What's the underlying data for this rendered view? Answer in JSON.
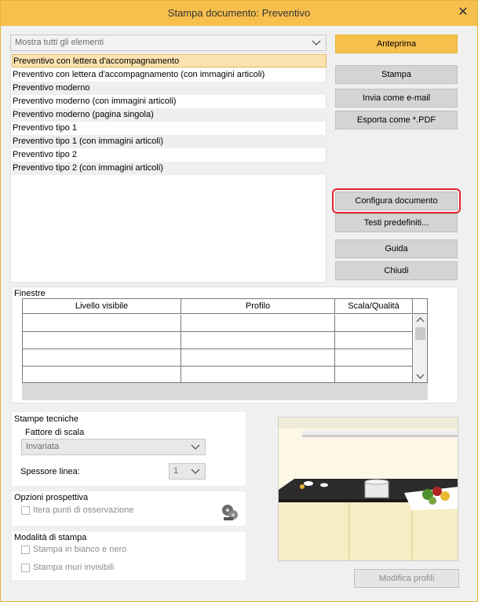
{
  "window": {
    "title": "Stampa documento: Preventivo"
  },
  "filter": {
    "value": "Mostra tutti gli elementi"
  },
  "templates": [
    "Preventivo con lettera d'accompagnamento",
    "Preventivo con lettera d'accompagnamento (con immagini articoli)",
    "Preventivo moderno",
    "Preventivo moderno (con immagini articoli)",
    "Preventivo moderno (pagina singola)",
    "Preventivo tipo 1",
    "Preventivo tipo 1 (con immagini articoli)",
    "Preventivo tipo 2",
    "Preventivo tipo 2 (con immagini articoli)"
  ],
  "buttons": {
    "preview": "Anteprima",
    "print": "Stampa",
    "email": "Invia come e-mail",
    "pdf": "Esporta come *.PDF",
    "configure": "Configura documento",
    "texts": "Testi predefiniti...",
    "help": "Guida",
    "close": "Chiudi",
    "edit_profiles": "Modifica profili"
  },
  "windows_section": {
    "label": "Finestre",
    "columns": [
      "Livello visibile",
      "Profilo",
      "Scala/Qualità"
    ]
  },
  "technical": {
    "label": "Stampe tecniche",
    "scale_label": "Fattore di scala",
    "scale_value": "Invariata",
    "line_label": "Spessore linea:",
    "line_value": "1"
  },
  "perspective": {
    "label": "Opzioni prospettiva",
    "iterate_label": "Itera punti di osservazione"
  },
  "print_mode": {
    "label": "Modalità di stampa",
    "bw_label": "Stampa in bianco e nero",
    "walls_label": "Stampa muri invisibili"
  },
  "colors": {
    "accent": "#f7c04d",
    "focus_ring": "#e32636"
  }
}
